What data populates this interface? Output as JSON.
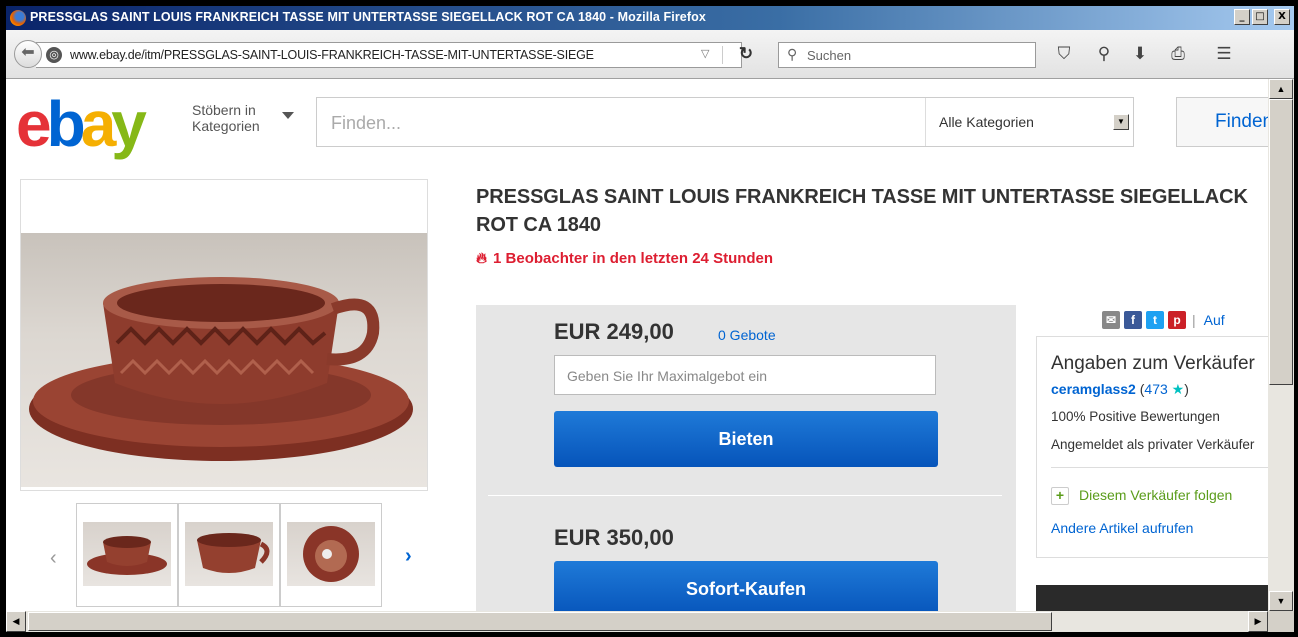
{
  "window": {
    "title": "PRESSGLAS SAINT LOUIS FRANKREICH TASSE MIT UNTERTASSE SIEGELLACK ROT CA 1840 - Mozilla Firefox",
    "min_label": "_",
    "max_label": "□",
    "close_label": "X"
  },
  "browser": {
    "url": "www.ebay.de/itm/PRESSGLAS-SAINT-LOUIS-FRANKREICH-TASSE-MIT-UNTERTASSE-SIEGE",
    "search_placeholder": "Suchen",
    "icons": [
      "back-icon",
      "globe-icon",
      "reload-icon",
      "search-icon",
      "pocket-icon",
      "search-glass-icon",
      "download-icon",
      "print-icon",
      "menu-icon"
    ]
  },
  "ebay": {
    "logo": {
      "e": "e",
      "b": "b",
      "a": "a",
      "y": "y"
    },
    "browse_line1": "Stöbern in",
    "browse_line2": "Kategorien",
    "find_placeholder": "Finden...",
    "category": "Alle Kategorien",
    "find_button": "Finden"
  },
  "item": {
    "title": "PRESSGLAS SAINT LOUIS FRANKREICH TASSE MIT UNTERTASSE SIEGELLACK ROT CA 1840",
    "watchers": "1 Beobachter in den letzten 24 Stunden",
    "auction_price": "EUR 249,00",
    "bids": "0 Gebote",
    "maxbid_placeholder": "Geben Sie Ihr Maximalgebot ein",
    "bid_button": "Bieten",
    "buy_price": "EUR 350,00",
    "buy_button": "Sofort-Kaufen"
  },
  "share": {
    "auf": "Auf"
  },
  "seller": {
    "heading": "Angaben zum Verkäufer",
    "name": "ceramglass2",
    "score_open": "(",
    "score": "473",
    "score_close": ")",
    "positive": "100% Positive Bewertungen",
    "type": "Angemeldet als privater Verkäufer",
    "follow": "Diesem Verkäufer folgen",
    "other": "Andere Artikel aufrufen"
  },
  "colors": {
    "ebay_red": "#e53238",
    "ebay_blue": "#0064d2",
    "ebay_yellow": "#f5af02",
    "ebay_green": "#86b817",
    "button_blue": "#0654ba",
    "watch_red": "#dd1e31",
    "product_red": "#8b3a2c"
  }
}
